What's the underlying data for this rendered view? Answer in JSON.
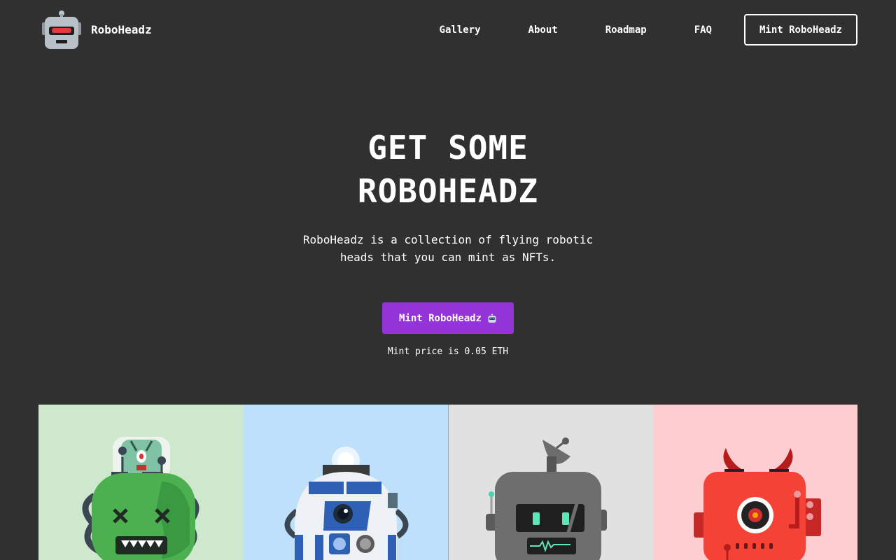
{
  "brand": {
    "name": "RoboHeadz",
    "logo_icon": "robot-head-logo-icon"
  },
  "nav": {
    "links": [
      {
        "label": "Gallery"
      },
      {
        "label": "About"
      },
      {
        "label": "Roadmap"
      },
      {
        "label": "FAQ"
      }
    ],
    "cta_label": "Mint RoboHeadz"
  },
  "hero": {
    "title_line1": "GET SOME",
    "title_line2": "ROBOHEADZ",
    "description": "RoboHeadz is a collection of flying robotic heads that you can mint as NFTs.",
    "mint_button_label": "Mint RoboHeadz",
    "mint_button_icon": "robot-emoji-icon",
    "mint_price": "Mint price is 0.05 ETH"
  },
  "gallery": {
    "tiles": [
      {
        "icon": "zombie-robot-icon",
        "background": "#cde8cc"
      },
      {
        "icon": "astromech-robot-icon",
        "background": "#bfe0fb"
      },
      {
        "icon": "antenna-robot-icon",
        "background": "#e1e1e1"
      },
      {
        "icon": "devil-robot-icon",
        "background": "#fecdd1"
      }
    ]
  },
  "colors": {
    "page_background": "#303030",
    "accent": "#9333d8",
    "text": "#ffffff"
  }
}
